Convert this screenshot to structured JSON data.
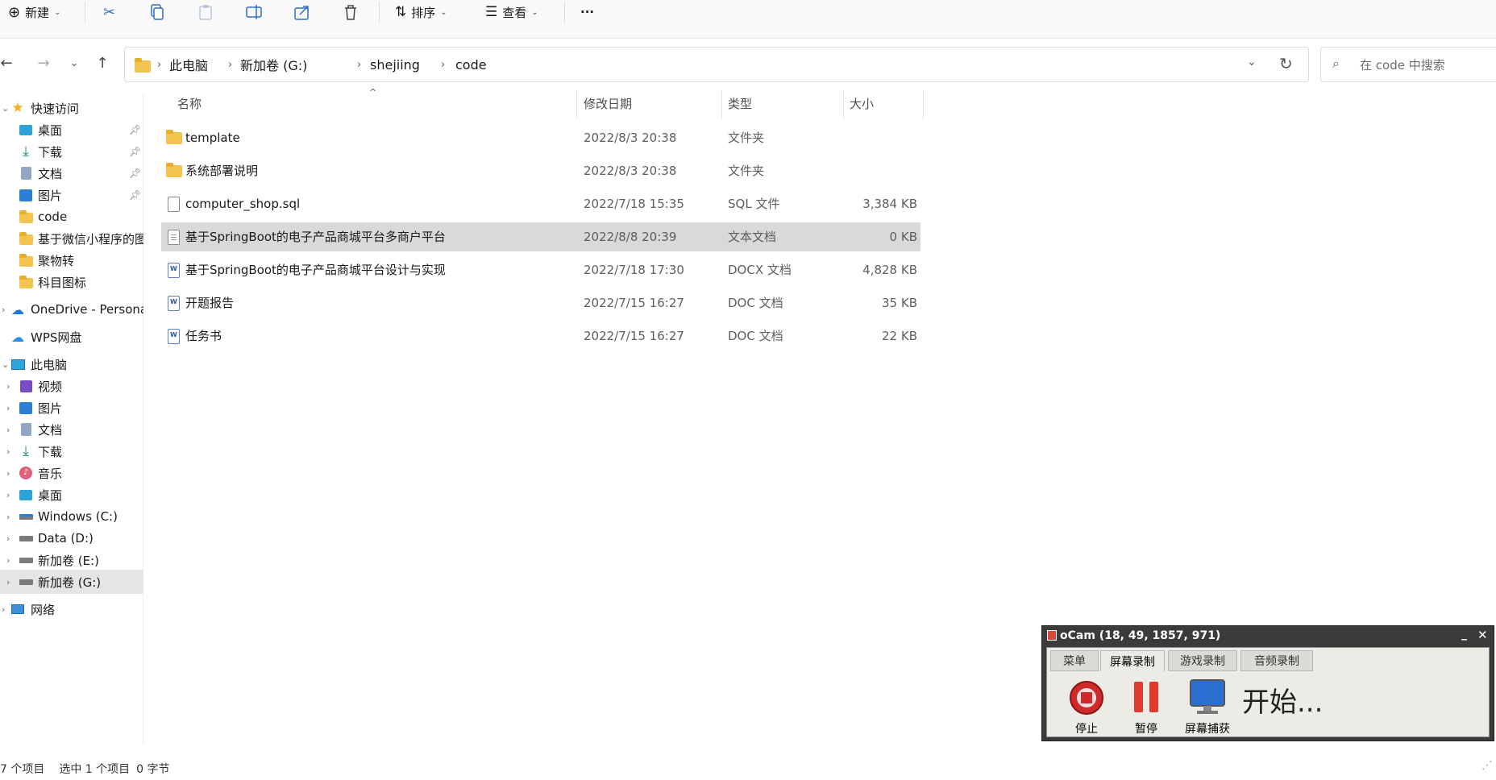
{
  "toolbar": {
    "new_label": "新建",
    "sort_label": "排序",
    "view_label": "查看",
    "more_label": "···"
  },
  "address": {
    "crumbs": [
      "此电脑",
      "新加卷 (G:)",
      "shejiing",
      "code"
    ],
    "search_placeholder": "在 code 中搜索"
  },
  "sidebar": {
    "quick_access": "快速访问",
    "items": [
      {
        "label": "桌面",
        "icon": "desktop-icon",
        "pinned": true
      },
      {
        "label": "下载",
        "icon": "download-icon",
        "pinned": true
      },
      {
        "label": "文档",
        "icon": "document-icon",
        "pinned": true
      },
      {
        "label": "图片",
        "icon": "picture-icon",
        "pinned": true
      },
      {
        "label": "code",
        "icon": "folder-icon",
        "pinned": false
      },
      {
        "label": "基于微信小程序的图",
        "icon": "folder-icon",
        "pinned": false
      },
      {
        "label": "聚物转",
        "icon": "folder-icon",
        "pinned": false
      },
      {
        "label": "科目图标",
        "icon": "folder-icon",
        "pinned": false
      }
    ],
    "onedrive": "OneDrive - Persona",
    "wps": "WPS网盘",
    "this_pc": "此电脑",
    "pc_items": [
      {
        "label": "视频",
        "icon": "video-icon"
      },
      {
        "label": "图片",
        "icon": "picture-icon"
      },
      {
        "label": "文档",
        "icon": "document-icon"
      },
      {
        "label": "下载",
        "icon": "download-icon"
      },
      {
        "label": "音乐",
        "icon": "music-icon"
      },
      {
        "label": "桌面",
        "icon": "desktop-icon"
      },
      {
        "label": "Windows (C:)",
        "icon": "drive-icon"
      },
      {
        "label": "Data (D:)",
        "icon": "drive-icon"
      },
      {
        "label": "新加卷 (E:)",
        "icon": "drive-icon"
      },
      {
        "label": "新加卷 (G:)",
        "icon": "drive-icon"
      }
    ],
    "network": "网络"
  },
  "columns": {
    "name": "名称",
    "date": "修改日期",
    "type": "类型",
    "size": "大小"
  },
  "files": [
    {
      "name": "template",
      "date": "2022/8/3 20:38",
      "type": "文件夹",
      "size": "",
      "icon": "folder"
    },
    {
      "name": "系统部署说明",
      "date": "2022/8/3 20:38",
      "type": "文件夹",
      "size": "",
      "icon": "folder"
    },
    {
      "name": "computer_shop.sql",
      "date": "2022/7/18 15:35",
      "type": "SQL 文件",
      "size": "3,384 KB",
      "icon": "file"
    },
    {
      "name": "基于SpringBoot的电子产品商城平台多商户平台",
      "date": "2022/8/8 20:39",
      "type": "文本文档",
      "size": "0 KB",
      "icon": "text"
    },
    {
      "name": "基于SpringBoot的电子产品商城平台设计与实现",
      "date": "2022/7/18 17:30",
      "type": "DOCX 文档",
      "size": "4,828 KB",
      "icon": "word"
    },
    {
      "name": "开题报告",
      "date": "2022/7/15 16:27",
      "type": "DOC 文档",
      "size": "35 KB",
      "icon": "word"
    },
    {
      "name": "任务书",
      "date": "2022/7/15 16:27",
      "type": "DOC 文档",
      "size": "22 KB",
      "icon": "word"
    }
  ],
  "status": {
    "count": "7 个项目",
    "selected": "选中 1 个项目",
    "selected_size": "0 字节"
  },
  "ocam": {
    "title": "oCam (18, 49, 1857, 971)",
    "tabs": [
      "菜单",
      "屏幕录制",
      "游戏录制",
      "音频录制"
    ],
    "buttons": [
      "停止",
      "暂停",
      "屏幕捕获"
    ],
    "status_text": "开始..."
  }
}
